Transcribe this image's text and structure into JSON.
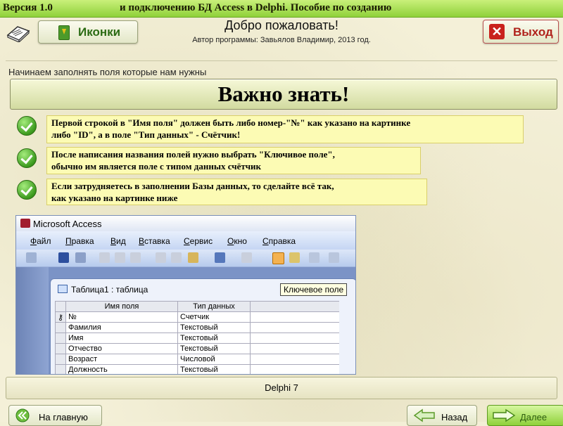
{
  "topbar": {
    "version": "Версия 1.0",
    "title": "и подключению БД Access в Delphi. Пособие по созданию"
  },
  "header": {
    "icons_button": "Иконки",
    "welcome": "Добро пожаловать!",
    "author": "Автор программы: Завьялов Владимир, 2013 год.",
    "exit_button": "Выход"
  },
  "content": {
    "instruction": "Начинаем заполнять поля которые нам нужны",
    "banner": "Важно знать!",
    "tips": [
      {
        "line1": "Первой строкой в \"Имя поля\" должен быть либо номер-\"№\" как указано на картинке",
        "line2": "либо \"ID\", а в поле \"Тип данных\" - Счётчик!"
      },
      {
        "line1": "После написания названия полей нужно выбрать \"Ключивое поле\",",
        "line2": "обычно им является поле с типом данных счётчик"
      },
      {
        "line1": "Если затрудняетесь в заполнении Базы данных, то сделайте всё так,",
        "line2": "как указано на картинке ниже"
      }
    ]
  },
  "access": {
    "window_title": "Microsoft Access",
    "menu": [
      "Файл",
      "Правка",
      "Вид",
      "Вставка",
      "Сервис",
      "Окно",
      "Справка"
    ],
    "table_title": "Таблица1 : таблица",
    "tooltip": "Ключевое поле",
    "columns": [
      "Имя поля",
      "Тип данных"
    ],
    "rows": [
      [
        "№",
        "Счетчик"
      ],
      [
        "Фамилия",
        "Текстовый"
      ],
      [
        "Имя",
        "Текстовый"
      ],
      [
        "Отчество",
        "Текстовый"
      ],
      [
        "Возраст",
        "Числовой"
      ],
      [
        "Должность",
        "Текстовый"
      ]
    ]
  },
  "status": "Delphi 7",
  "nav": {
    "home": "На главную",
    "back": "Назад",
    "next": "Далее"
  },
  "colors": {
    "topbar": "#a6e04f",
    "tip_bg": "#fcfbb4",
    "exit_red": "#c9221d",
    "access_blue": "#7b93c6"
  }
}
